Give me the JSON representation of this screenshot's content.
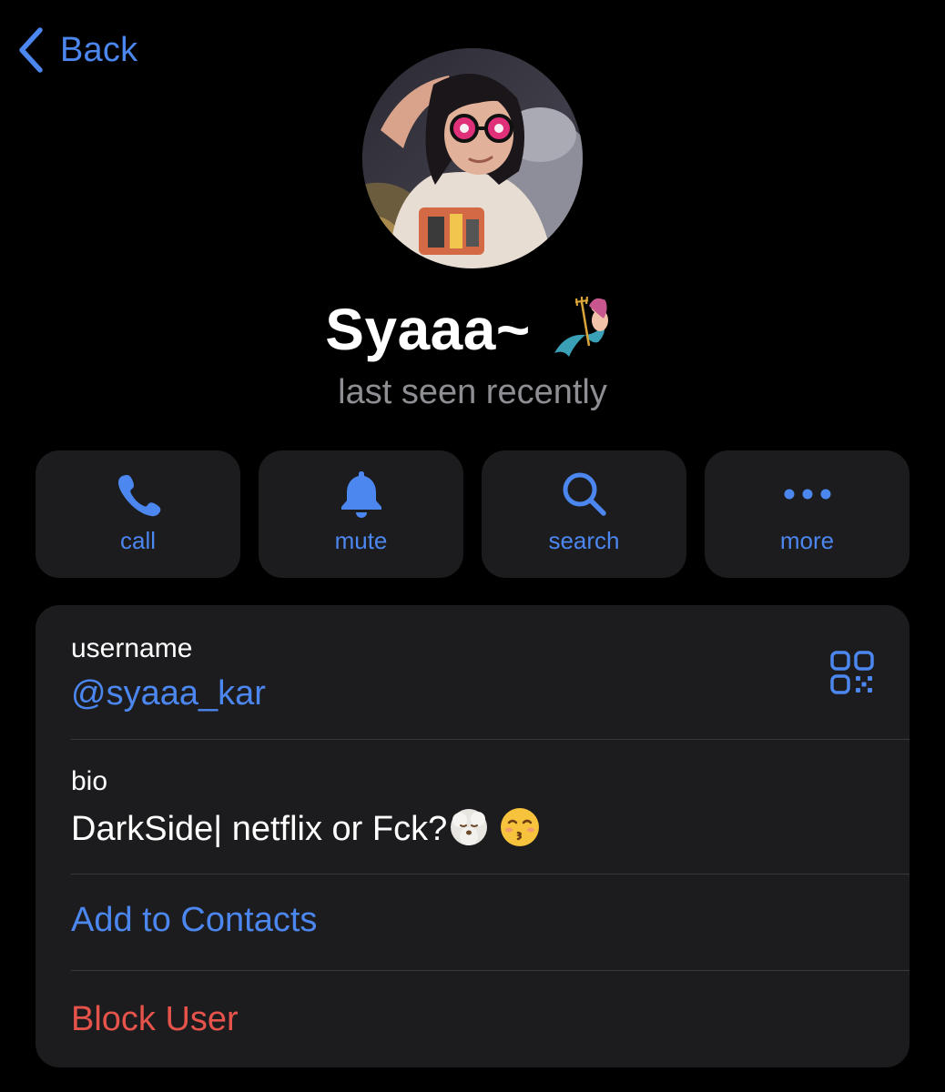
{
  "nav": {
    "back_label": "Back",
    "back_icon": "chevron-left-icon"
  },
  "profile": {
    "name": "Syaaa~",
    "name_emoji": "mermaid-emoji",
    "status": "last seen recently"
  },
  "actions": [
    {
      "label": "call",
      "icon": "phone-icon"
    },
    {
      "label": "mute",
      "icon": "bell-icon"
    },
    {
      "label": "search",
      "icon": "search-icon"
    },
    {
      "label": "more",
      "icon": "ellipsis-icon"
    }
  ],
  "info": {
    "username_label": "username",
    "username_value": "@syaaa_kar",
    "bio_label": "bio",
    "bio_value": "DarkSide| netflix or Fck?",
    "bio_emojis": [
      "face-exhaling-emoji",
      "kissing-face-emoji"
    ],
    "add_contacts": "Add to Contacts",
    "block_user": "Block User"
  },
  "colors": {
    "background": "#000000",
    "card": "#1c1c1e",
    "accent_blue": "#4c86ef",
    "destructive_red": "#e5534b",
    "secondary_text": "#8e8e93",
    "separator": "#38383a"
  }
}
